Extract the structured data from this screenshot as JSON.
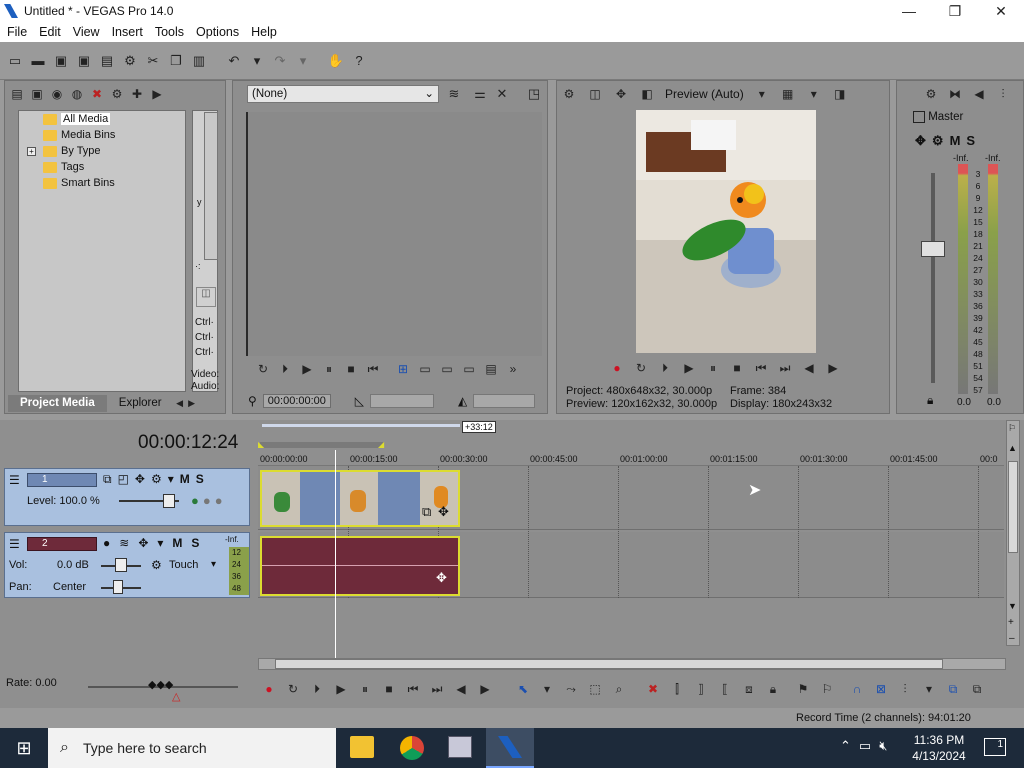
{
  "window": {
    "title": "Untitled * - VEGAS Pro 14.0",
    "controls": {
      "minimize": "—",
      "maximize": "❐",
      "close": "✕"
    }
  },
  "menu": [
    "File",
    "Edit",
    "View",
    "Insert",
    "Tools",
    "Options",
    "Help"
  ],
  "project_media": {
    "tree": [
      "All Media",
      "Media Bins",
      "By Type",
      "Tags",
      "Smart Bins"
    ],
    "expand_glyph": "+",
    "list_fragments": {
      "top1": "y",
      "top2": "·:",
      "ctrl1": "Ctrl·",
      "ctrl2": "Ctrl·",
      "ctrl3": "Ctrl·",
      "video": "Video:",
      "audio": "Audio:"
    },
    "tabs": [
      "Project Media",
      "Explorer"
    ]
  },
  "trimmer": {
    "dropdown_value": "(None)",
    "timecode": "00:00:00:00"
  },
  "preview": {
    "mode": "Preview (Auto)",
    "project_label": "Project:",
    "project_value": "480x648x32, 30.000p",
    "preview_label": "Preview:",
    "preview_value": "120x162x32, 30.000p",
    "frame_label": "Frame:",
    "frame_value": "384",
    "display_label": "Display:",
    "display_value": "180x243x32"
  },
  "master": {
    "label": "Master",
    "m": "M",
    "s": "S",
    "inf_left": "-Inf.",
    "inf_right": "-Inf.",
    "scale": [
      "3",
      "6",
      "9",
      "12",
      "15",
      "18",
      "21",
      "24",
      "27",
      "30",
      "33",
      "36",
      "39",
      "42",
      "45",
      "48",
      "51",
      "54",
      "57"
    ],
    "readout_left": "0.0",
    "readout_right": "0.0"
  },
  "timeline": {
    "timecode": "00:00:12:24",
    "loop_region": "+33:12",
    "ruler": [
      "00:00:00:00",
      "00:00:15:00",
      "00:00:30:00",
      "00:00:45:00",
      "00:01:00:00",
      "00:01:15:00",
      "00:01:30:00",
      "00:01:45:00",
      "00:0"
    ],
    "video_track": {
      "number": "1",
      "level": "Level: 100.0 %",
      "m": "M",
      "s": "S"
    },
    "audio_track": {
      "number": "2",
      "vol_label": "Vol:",
      "vol_value": "0.0 dB",
      "pan_label": "Pan:",
      "pan_value": "Center",
      "touch": "Touch",
      "m": "M",
      "s": "S",
      "inf": "-Inf.",
      "meter": [
        "12",
        "24",
        "36",
        "48"
      ]
    },
    "rate": "Rate: 0.00"
  },
  "status": {
    "record_time": "Record Time (2 channels): 94:01:20"
  },
  "taskbar": {
    "search_placeholder": "Type here to search",
    "time": "11:36 PM",
    "date": "4/13/2024",
    "notification_count": "1"
  }
}
